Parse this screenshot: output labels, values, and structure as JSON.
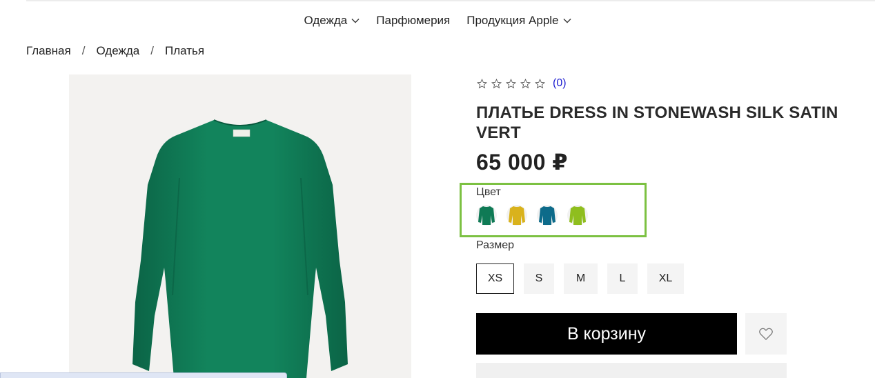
{
  "nav": {
    "items": [
      {
        "label": "Одежда",
        "has_dropdown": true
      },
      {
        "label": "Парфюмерия",
        "has_dropdown": false
      },
      {
        "label": "Продукция Apple",
        "has_dropdown": true
      }
    ]
  },
  "breadcrumb": {
    "items": [
      "Главная",
      "Одежда",
      "Платья"
    ],
    "separator": "/"
  },
  "product": {
    "rating_count": "(0)",
    "rating_value": 0,
    "rating_max": 5,
    "title": "ПЛАТЬЕ DRESS IN STONEWASH SILK SATIN VERT",
    "price": "65 000 ₽",
    "image_icon": "green-dress-image",
    "color_label": "Цвет",
    "colors": [
      {
        "name": "green",
        "hex": "#0f7a55"
      },
      {
        "name": "yellow",
        "hex": "#d9b21c"
      },
      {
        "name": "teal-blue",
        "hex": "#0d6b8a"
      },
      {
        "name": "lime",
        "hex": "#8fbe1e"
      }
    ],
    "size_label": "Размер",
    "sizes": [
      "XS",
      "S",
      "M",
      "L",
      "XL"
    ],
    "selected_size": "XS",
    "add_to_cart_label": "В корзину",
    "favorite_icon": "heart-icon"
  },
  "theme": {
    "accent_highlight": "#7cc142",
    "rating_link": "#1b1bd0",
    "cart_bg": "#000000",
    "dress_green": "#0f7a55"
  }
}
